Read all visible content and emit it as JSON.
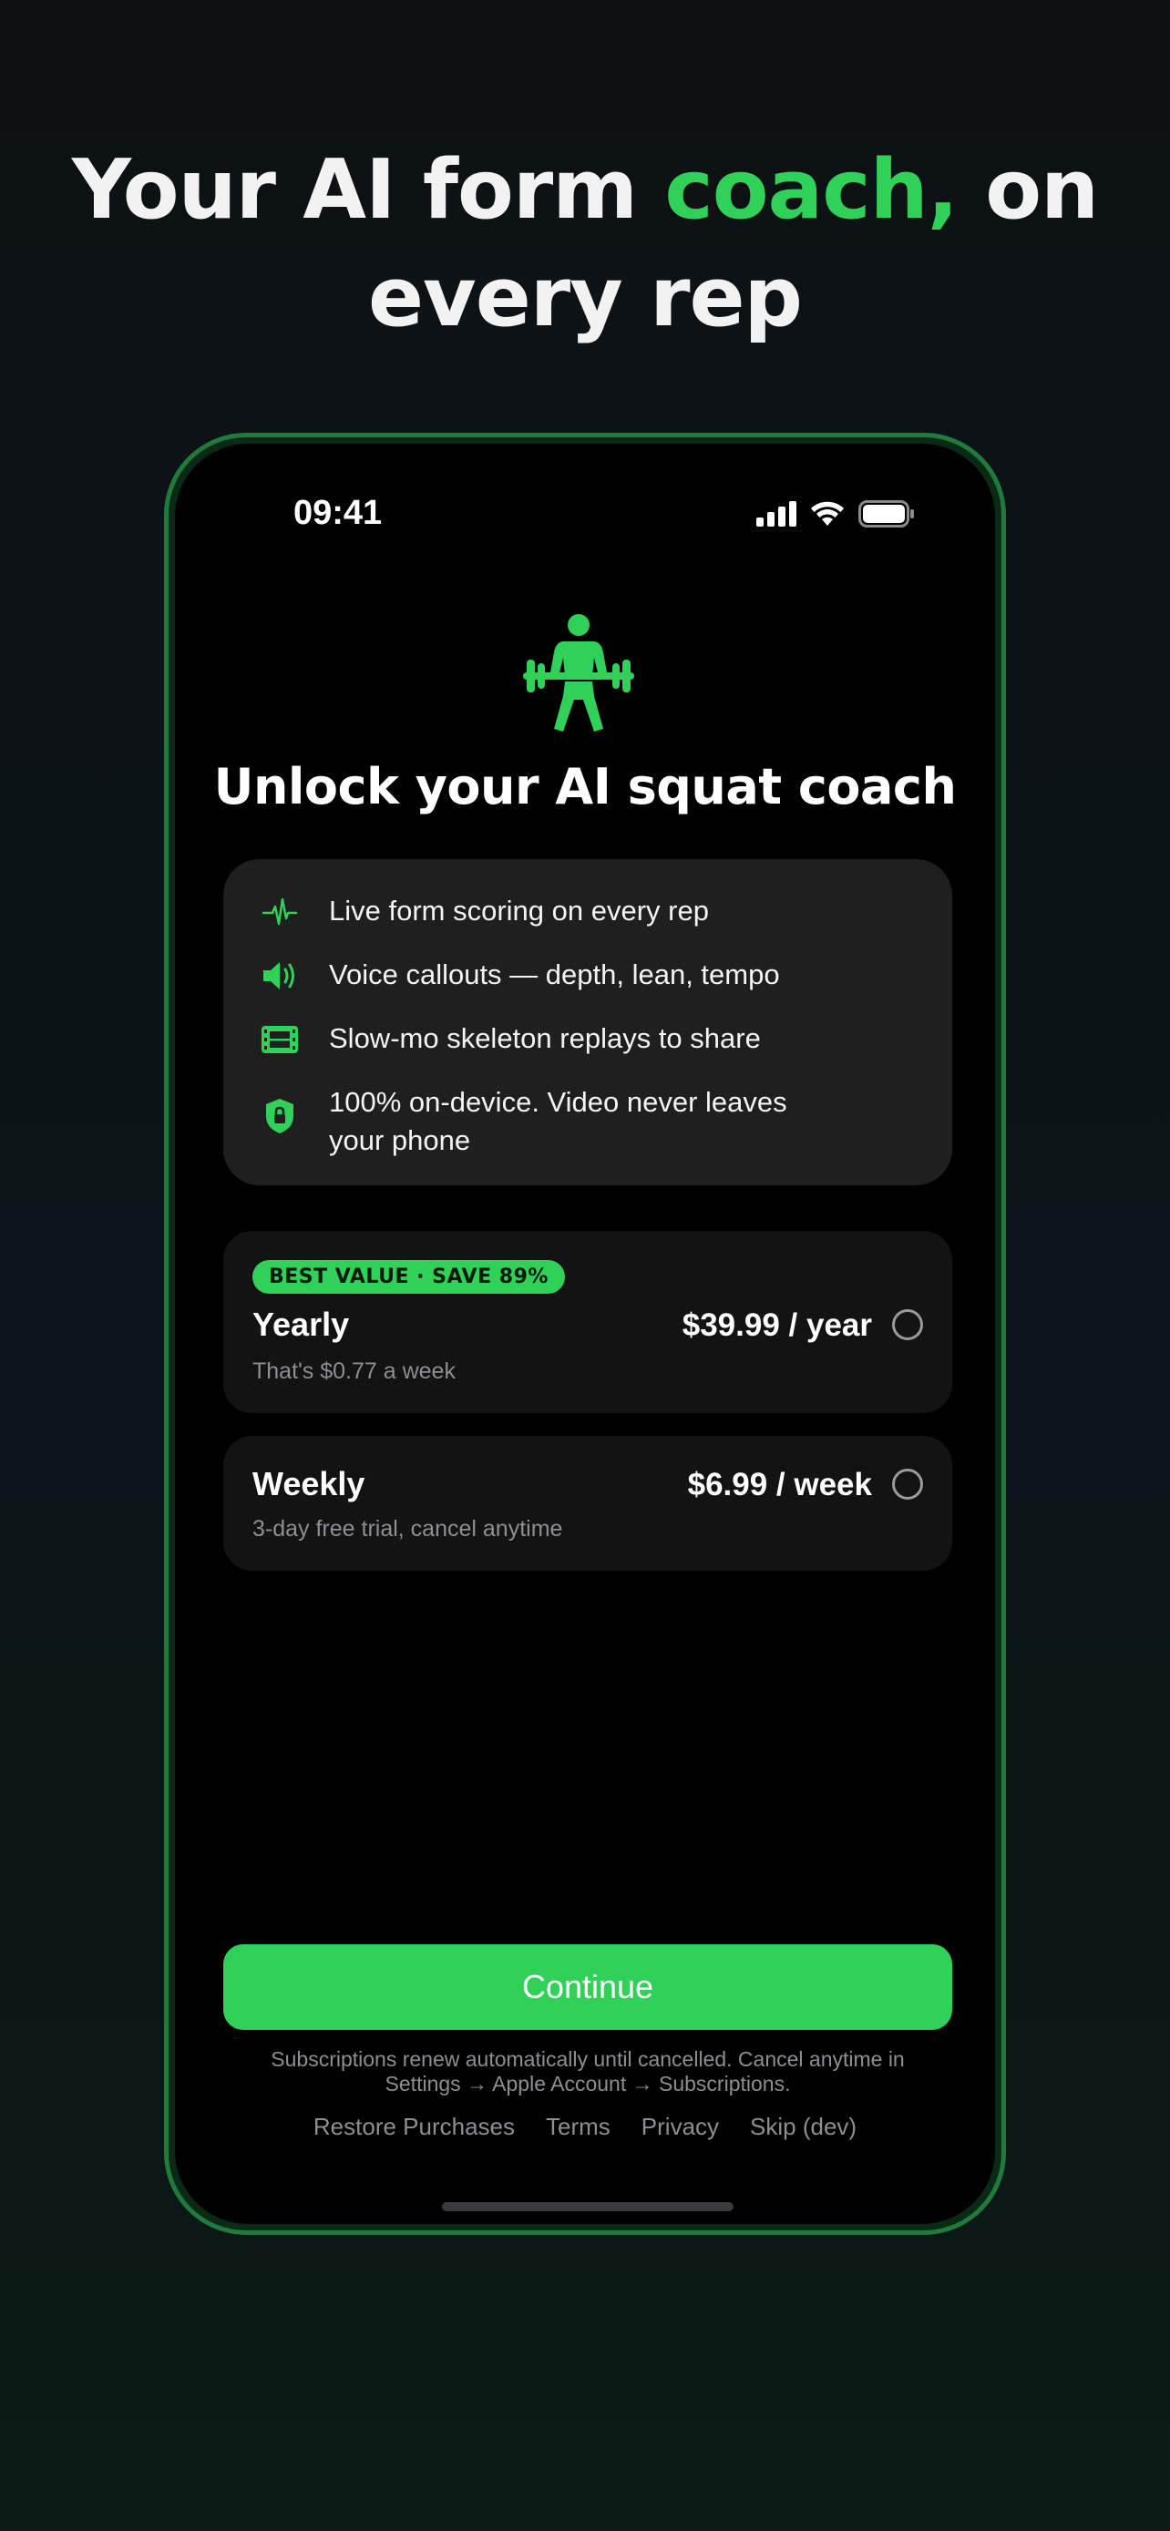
{
  "headline": {
    "part1": "Your AI form ",
    "accent": "coach,",
    "part2": " on every rep"
  },
  "status_bar": {
    "time": "09:41"
  },
  "paywall": {
    "title": "Unlock your AI squat coach",
    "features": [
      {
        "icon": "waveform-icon",
        "text": "Live form scoring on every rep"
      },
      {
        "icon": "speaker-icon",
        "text": "Voice callouts — depth, lean, tempo"
      },
      {
        "icon": "film-icon",
        "text": "Slow-mo skeleton replays to share"
      },
      {
        "icon": "lock-shield-icon",
        "text": "100% on-device. Video never leaves your phone"
      }
    ],
    "plans": {
      "yearly": {
        "badge": "BEST VALUE · SAVE 89%",
        "name": "Yearly",
        "price": "$39.99 / year",
        "subtitle": "That's $0.77 a week",
        "selected": false
      },
      "weekly": {
        "name": "Weekly",
        "price": "$6.99 / week",
        "subtitle": "3-day free trial, cancel anytime",
        "selected": false
      }
    },
    "continue_label": "Continue",
    "legal": "Subscriptions renew automatically until cancelled. Cancel anytime in Settings → Apple Account → Subscriptions.",
    "links": {
      "restore": "Restore Purchases",
      "terms": "Terms",
      "privacy": "Privacy",
      "skip": "Skip (dev)"
    }
  },
  "colors": {
    "accent": "#30d158",
    "background": "#0d1114",
    "card": "#1f1f1f",
    "plan_card": "#131313",
    "phone_border": "#1f7a3c"
  }
}
